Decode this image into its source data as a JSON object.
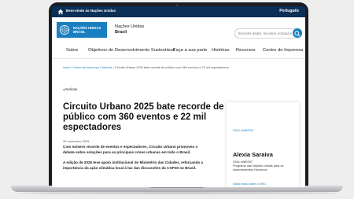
{
  "topbar": {
    "welcome": "Bem-vindo às Nações Unidas",
    "language": "Português"
  },
  "logo": {
    "line1": "NAÇÕES UNIDAS",
    "line2": "BRASIL"
  },
  "site": {
    "line1": "Nações Unidas",
    "line2": "Brasil"
  },
  "search": {
    "placeholder": "Encontre dados, recursos, notícias e mais"
  },
  "nav": [
    "Sobre",
    "Objetivos de Desenvolvimento Sustentável",
    "Faça a sua parte",
    "Histórias",
    "Recursos",
    "Centro de Imprensa"
  ],
  "breadcrumb": {
    "home": "Início",
    "sep": " / ",
    "press": "Centro de Imprensa",
    "news": "Notícias",
    "current": "Circuito Urbano 2025 bate recorde de público com 360 eventos e 22 mil espectadores"
  },
  "back": "◂  Notícias",
  "article": {
    "title": "Circuito Urbano 2025 bate recorde de público com 360 eventos e 22 mil espectadores",
    "date": "20 novembro 2025",
    "p1": "Com número recorde de eventos e espectadores, Circuito Urbano promoveu o debate sobre soluções para as principais crises urbanas em todo o Brasil.",
    "p2": "A edição de 2025 teve apoio institucional do Ministério das Cidades, reforçando a importância da ação climática local à luz das discussões da COP30 no Brasil."
  },
  "card": {
    "tag": "ONU-HABITAT",
    "author": "Alexia Saraiva",
    "org": "ONU-HABITAT",
    "role": "Programa das Nações Unidas para os Assentamentos Humanos",
    "link": "Saiba mais sobre a ONU"
  },
  "colors": {
    "brand": "#1a7fc1",
    "topbar": "#0b2f57"
  }
}
